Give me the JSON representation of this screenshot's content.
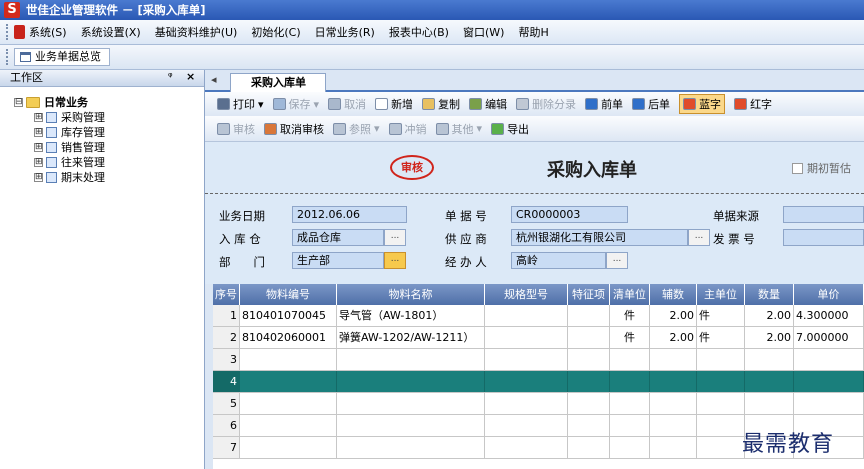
{
  "window": {
    "title": "世佳企业管理软件 － [采购入库单]",
    "app_icon_letter": "S"
  },
  "menu": [
    "系统(S)",
    "系统设置(X)",
    "基础资料维护(U)",
    "初始化(C)",
    "日常业务(R)",
    "报表中心(B)",
    "窗口(W)",
    "帮助H"
  ],
  "quick_tab": "业务单据总览",
  "workspace": {
    "title": "工作区",
    "pin": "ᵠ",
    "close": "×",
    "root": "日常业务",
    "root_expander": "⊟",
    "expander": "⊞",
    "children": [
      "采购管理",
      "库存管理",
      "销售管理",
      "往来管理",
      "期末处理"
    ]
  },
  "doc_tab": {
    "nav": "◂",
    "label": "采购入库单"
  },
  "toolbar1": [
    {
      "label": "打印",
      "arrow": "▾",
      "enabled": true,
      "color": "#5a6f8f"
    },
    {
      "label": "保存",
      "arrow": "▾",
      "enabled": false,
      "color": "#9fb8d8"
    },
    {
      "label": "取消",
      "enabled": false,
      "color": "#a9b8cc"
    },
    {
      "label": "新增",
      "enabled": true,
      "color": "#ffffff"
    },
    {
      "label": "复制",
      "enabled": true,
      "color": "#e8c060"
    },
    {
      "label": "编辑",
      "enabled": true,
      "color": "#7aa04a"
    },
    {
      "label": "删除分录",
      "enabled": false,
      "color": "#c0c8d4"
    },
    {
      "label": "前单",
      "enabled": true,
      "color": "#2f6fc9"
    },
    {
      "label": "后单",
      "enabled": true,
      "color": "#2f6fc9"
    },
    {
      "label": "蓝字",
      "enabled": true,
      "pressed": true,
      "color": "#e04b2a"
    },
    {
      "label": "红字",
      "enabled": true,
      "color": "#e04b2a"
    }
  ],
  "toolbar2": [
    {
      "label": "审核",
      "enabled": false,
      "color": "#b8c4d4"
    },
    {
      "label": "取消审核",
      "enabled": true,
      "color": "#d9773a"
    },
    {
      "label": "参照",
      "arrow": "▾",
      "enabled": false,
      "color": "#b8c4d4"
    },
    {
      "label": "冲销",
      "enabled": false,
      "color": "#b8c4d4"
    },
    {
      "label": "其他",
      "arrow": "▾",
      "enabled": false,
      "color": "#b8c4d4"
    },
    {
      "label": "导出",
      "enabled": true,
      "color": "#5ab04a"
    }
  ],
  "form": {
    "stamp": "审核",
    "title": "采购入库单",
    "initial_suspend": "期初暂估",
    "browse": "...",
    "business_date": {
      "label": "业务日期",
      "value": "2012.06.06"
    },
    "doc_no": {
      "label": "单 据 号",
      "value": "CR0000003"
    },
    "source": {
      "label": "单据来源",
      "value": ""
    },
    "warehouse": {
      "label": "入 库 仓",
      "value": "成品仓库"
    },
    "supplier": {
      "label": "供 应 商",
      "value": "杭州银湖化工有限公司"
    },
    "invoice_no": {
      "label": "发 票 号",
      "value": ""
    },
    "department": {
      "label": "部　　门",
      "value": "生产部"
    },
    "handler": {
      "label": "经 办 人",
      "value": "高岭"
    }
  },
  "grid": {
    "headers": [
      "序号",
      "物料编号",
      "物料名称",
      "规格型号",
      "特征项",
      "清单位",
      "辅数",
      "主单位",
      "数量",
      "单价"
    ],
    "rows": [
      [
        "1",
        "810401070045",
        "导气管（AW-1801）",
        "",
        "",
        "件",
        "2.00",
        "件",
        "2.00",
        "4.300000"
      ],
      [
        "2",
        "810402060001",
        "弹簧AW-1202/AW-1211）",
        "",
        "",
        "件",
        "2.00",
        "件",
        "2.00",
        "7.000000"
      ],
      [
        "3",
        "",
        "",
        "",
        "",
        "",
        "",
        "",
        "",
        ""
      ],
      [
        "4",
        "",
        "",
        "",
        "",
        "",
        "",
        "",
        "",
        ""
      ],
      [
        "5",
        "",
        "",
        "",
        "",
        "",
        "",
        "",
        "",
        ""
      ],
      [
        "6",
        "",
        "",
        "",
        "",
        "",
        "",
        "",
        "",
        ""
      ],
      [
        "7",
        "",
        "",
        "",
        "",
        "",
        "",
        "",
        "",
        ""
      ]
    ],
    "selected_row": 3
  },
  "watermark": "最需教育"
}
